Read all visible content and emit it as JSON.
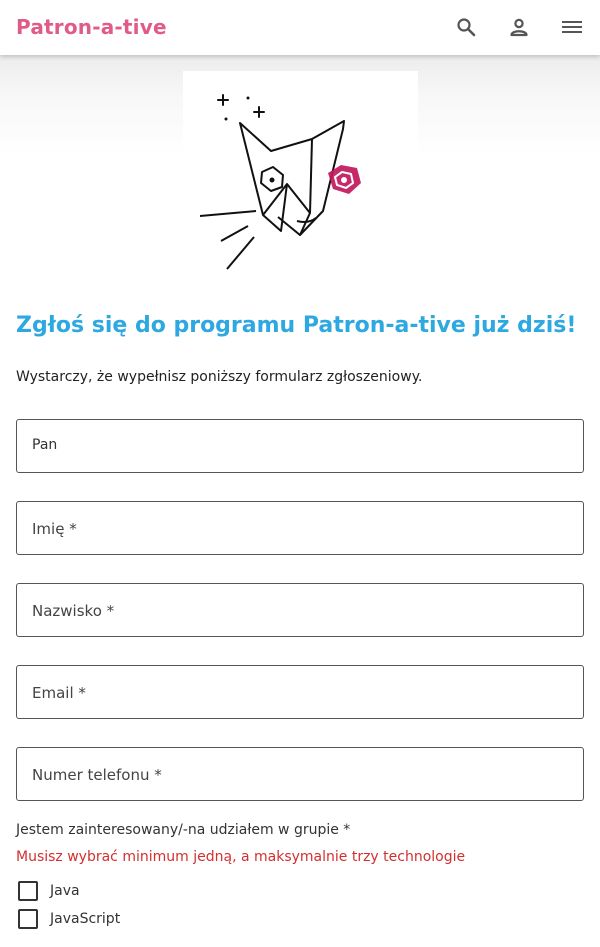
{
  "header": {
    "brand": "Patron-a-tive",
    "icons": [
      "search-icon",
      "person-icon",
      "menu-icon"
    ]
  },
  "colors": {
    "brand": "#e05a8a",
    "title": "#2ea8e0",
    "error": "#d32f2f",
    "logo_accent": "#c2185b"
  },
  "main": {
    "title": "Zgłoś się do programu Patron-a-tive już dziś!",
    "intro": "Wystarczy, że wypełnisz poniższy formularz zgłoszeniowy."
  },
  "form": {
    "salutation_value": "Pan",
    "first_name_label": "Imię *",
    "last_name_label": "Nazwisko *",
    "email_label": "Email *",
    "phone_label": "Numer telefonu *",
    "group_label": "Jestem zainteresowany/-na udziałem w grupie *",
    "group_error": "Musisz wybrać minimum jedną, a maksymalnie trzy technologie",
    "options": [
      {
        "label": "Java",
        "checked": false
      },
      {
        "label": "JavaScript",
        "checked": false
      }
    ]
  }
}
